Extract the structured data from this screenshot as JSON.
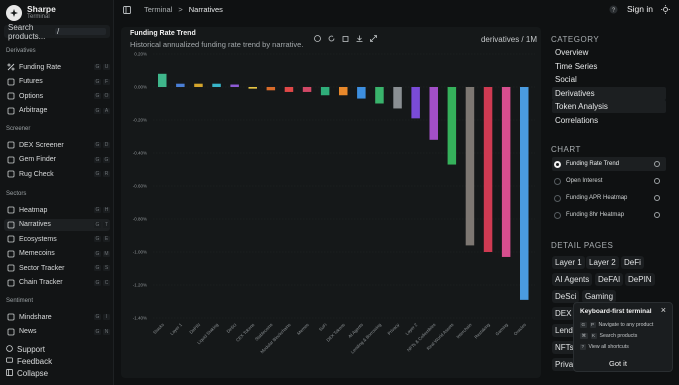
{
  "brand": {
    "name": "Sharpe",
    "sub": "Terminal"
  },
  "search": {
    "placeholder": "Search products...",
    "shortcut": "/"
  },
  "sidebar": {
    "sections": [
      {
        "title": "Derivatives",
        "items": [
          {
            "label": "Funding Rate",
            "keys": [
              "G",
              "U"
            ],
            "icon": "percent-icon"
          },
          {
            "label": "Futures",
            "keys": [
              "G",
              "F"
            ],
            "icon": "futures-icon"
          },
          {
            "label": "Options",
            "keys": [
              "G",
              "O"
            ],
            "icon": "options-icon"
          },
          {
            "label": "Arbitrage",
            "keys": [
              "G",
              "A"
            ],
            "icon": "arbitrage-icon"
          }
        ]
      },
      {
        "title": "Screener",
        "items": [
          {
            "label": "DEX Screener",
            "keys": [
              "G",
              "D"
            ],
            "icon": "dex-icon"
          },
          {
            "label": "Gem Finder",
            "keys": [
              "G",
              "G"
            ],
            "icon": "gem-icon"
          },
          {
            "label": "Rug Check",
            "keys": [
              "G",
              "R"
            ],
            "icon": "shield-icon"
          }
        ]
      },
      {
        "title": "Sectors",
        "items": [
          {
            "label": "Heatmap",
            "keys": [
              "G",
              "H"
            ],
            "icon": "grid-icon"
          },
          {
            "label": "Narratives",
            "keys": [
              "G",
              "T"
            ],
            "icon": "narratives-icon"
          },
          {
            "label": "Ecosystems",
            "keys": [
              "G",
              "E"
            ],
            "icon": "ecosystem-icon"
          },
          {
            "label": "Memecoins",
            "keys": [
              "G",
              "M"
            ],
            "icon": "memecoin-icon"
          },
          {
            "label": "Sector Tracker",
            "keys": [
              "G",
              "S"
            ],
            "icon": "tracker-icon"
          },
          {
            "label": "Chain Tracker",
            "keys": [
              "G",
              "C"
            ],
            "icon": "chain-icon"
          }
        ]
      },
      {
        "title": "Sentiment",
        "items": [
          {
            "label": "Mindshare",
            "keys": [
              "G",
              "I"
            ],
            "icon": "mindshare-icon"
          },
          {
            "label": "News",
            "keys": [
              "G",
              "N"
            ],
            "icon": "news-icon"
          }
        ]
      }
    ],
    "bottom": [
      "Support",
      "Feedback",
      "Collapse"
    ]
  },
  "topbar": {
    "crumb_root": "Terminal",
    "crumb_sep": ">",
    "crumb_current": "Narratives",
    "signin": "Sign in"
  },
  "chart_panel": {
    "title": "Funding Rate Trend",
    "subtitle": "Historical annualized funding rate trend by narrative.",
    "meta": "derivatives / 1M"
  },
  "right_panel": {
    "category_title": "CATEGORY",
    "categories": [
      "Overview",
      "Time Series",
      "Social",
      "Derivatives",
      "Token Analysis",
      "Correlations"
    ],
    "chart_title": "CHART",
    "charts": [
      "Funding Rate Trend",
      "Open Interest",
      "Funding APR Heatmap",
      "Funding 8hr Heatmap"
    ],
    "detail_title": "DETAIL PAGES",
    "detail_tags": [
      "Layer 1",
      "Layer 2",
      "DeFi",
      "AI Agents",
      "DeFAI",
      "DePIN",
      "DeSci",
      "Gaming",
      "DEX",
      "Lend",
      "NFTs",
      "Priva"
    ]
  },
  "popup": {
    "title": "Keyboard-first terminal",
    "close": "×",
    "rows": [
      {
        "keys": [
          "G",
          "P"
        ],
        "text": "Navigate to any product"
      },
      {
        "keys": [
          "⌘",
          "K"
        ],
        "text": "Search products"
      },
      {
        "keys": [
          "?"
        ],
        "text": "View all shortcuts"
      }
    ],
    "button": "Got it"
  },
  "chart_data": {
    "type": "bar",
    "title": "Funding Rate Trend",
    "ylim": [
      -1.45,
      0.2
    ],
    "yticks": [
      "0.20%",
      "0.00%",
      "-0.20%",
      "-0.40%",
      "-0.60%",
      "-0.80%",
      "-1.00%",
      "-1.20%",
      "-1.40%"
    ],
    "ytick_values": [
      0.2,
      0,
      -0.2,
      -0.4,
      -0.6,
      -0.8,
      -1.0,
      -1.2,
      -1.4
    ],
    "categories": [
      "Stacks",
      "Layer 1",
      "DePIN",
      "Liquid Staking",
      "DeSci",
      "CEX Tokens",
      "Stablecoins",
      "Modular Blockchains",
      "Memes",
      "SoFi",
      "DEX Tokens",
      "AI Agents",
      "Lending & Borrowing",
      "Privacy",
      "Layer 2",
      "NFTs & Collectibles",
      "Real World Assets",
      "Interchain",
      "Restaking",
      "Gaming",
      "Oracles"
    ],
    "values": [
      0.08,
      0.02,
      0.02,
      0.02,
      0.015,
      -0.01,
      -0.02,
      -0.03,
      -0.03,
      -0.05,
      -0.05,
      -0.07,
      -0.1,
      -0.13,
      -0.19,
      -0.32,
      -0.47,
      -0.96,
      -1.0,
      -1.03,
      -1.29
    ],
    "colors": [
      "#3fb68b",
      "#4a7fd6",
      "#d4a52c",
      "#38b5c9",
      "#8e5bd6",
      "#e6c544",
      "#d96b2a",
      "#e04848",
      "#d14866",
      "#2fae7a",
      "#e8882b",
      "#3d8fe0",
      "#39b36c",
      "#8a8f93",
      "#7a4bd8",
      "#a24fc7",
      "#35b15b",
      "#7d7772",
      "#cf3a52",
      "#d64e8e",
      "#4a9be0"
    ]
  }
}
